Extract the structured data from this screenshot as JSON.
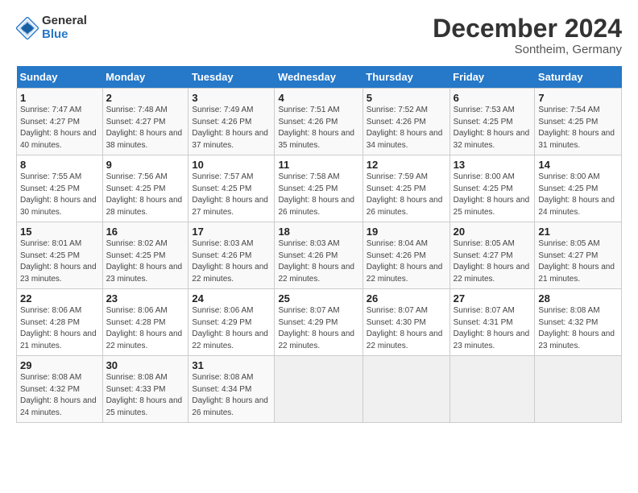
{
  "logo": {
    "general": "General",
    "blue": "Blue"
  },
  "header": {
    "month": "December 2024",
    "location": "Sontheim, Germany"
  },
  "days_of_week": [
    "Sunday",
    "Monday",
    "Tuesday",
    "Wednesday",
    "Thursday",
    "Friday",
    "Saturday"
  ],
  "weeks": [
    [
      {
        "num": "1",
        "sunrise": "Sunrise: 7:47 AM",
        "sunset": "Sunset: 4:27 PM",
        "daylight": "Daylight: 8 hours and 40 minutes."
      },
      {
        "num": "2",
        "sunrise": "Sunrise: 7:48 AM",
        "sunset": "Sunset: 4:27 PM",
        "daylight": "Daylight: 8 hours and 38 minutes."
      },
      {
        "num": "3",
        "sunrise": "Sunrise: 7:49 AM",
        "sunset": "Sunset: 4:26 PM",
        "daylight": "Daylight: 8 hours and 37 minutes."
      },
      {
        "num": "4",
        "sunrise": "Sunrise: 7:51 AM",
        "sunset": "Sunset: 4:26 PM",
        "daylight": "Daylight: 8 hours and 35 minutes."
      },
      {
        "num": "5",
        "sunrise": "Sunrise: 7:52 AM",
        "sunset": "Sunset: 4:26 PM",
        "daylight": "Daylight: 8 hours and 34 minutes."
      },
      {
        "num": "6",
        "sunrise": "Sunrise: 7:53 AM",
        "sunset": "Sunset: 4:25 PM",
        "daylight": "Daylight: 8 hours and 32 minutes."
      },
      {
        "num": "7",
        "sunrise": "Sunrise: 7:54 AM",
        "sunset": "Sunset: 4:25 PM",
        "daylight": "Daylight: 8 hours and 31 minutes."
      }
    ],
    [
      {
        "num": "8",
        "sunrise": "Sunrise: 7:55 AM",
        "sunset": "Sunset: 4:25 PM",
        "daylight": "Daylight: 8 hours and 30 minutes."
      },
      {
        "num": "9",
        "sunrise": "Sunrise: 7:56 AM",
        "sunset": "Sunset: 4:25 PM",
        "daylight": "Daylight: 8 hours and 28 minutes."
      },
      {
        "num": "10",
        "sunrise": "Sunrise: 7:57 AM",
        "sunset": "Sunset: 4:25 PM",
        "daylight": "Daylight: 8 hours and 27 minutes."
      },
      {
        "num": "11",
        "sunrise": "Sunrise: 7:58 AM",
        "sunset": "Sunset: 4:25 PM",
        "daylight": "Daylight: 8 hours and 26 minutes."
      },
      {
        "num": "12",
        "sunrise": "Sunrise: 7:59 AM",
        "sunset": "Sunset: 4:25 PM",
        "daylight": "Daylight: 8 hours and 26 minutes."
      },
      {
        "num": "13",
        "sunrise": "Sunrise: 8:00 AM",
        "sunset": "Sunset: 4:25 PM",
        "daylight": "Daylight: 8 hours and 25 minutes."
      },
      {
        "num": "14",
        "sunrise": "Sunrise: 8:00 AM",
        "sunset": "Sunset: 4:25 PM",
        "daylight": "Daylight: 8 hours and 24 minutes."
      }
    ],
    [
      {
        "num": "15",
        "sunrise": "Sunrise: 8:01 AM",
        "sunset": "Sunset: 4:25 PM",
        "daylight": "Daylight: 8 hours and 23 minutes."
      },
      {
        "num": "16",
        "sunrise": "Sunrise: 8:02 AM",
        "sunset": "Sunset: 4:25 PM",
        "daylight": "Daylight: 8 hours and 23 minutes."
      },
      {
        "num": "17",
        "sunrise": "Sunrise: 8:03 AM",
        "sunset": "Sunset: 4:26 PM",
        "daylight": "Daylight: 8 hours and 22 minutes."
      },
      {
        "num": "18",
        "sunrise": "Sunrise: 8:03 AM",
        "sunset": "Sunset: 4:26 PM",
        "daylight": "Daylight: 8 hours and 22 minutes."
      },
      {
        "num": "19",
        "sunrise": "Sunrise: 8:04 AM",
        "sunset": "Sunset: 4:26 PM",
        "daylight": "Daylight: 8 hours and 22 minutes."
      },
      {
        "num": "20",
        "sunrise": "Sunrise: 8:05 AM",
        "sunset": "Sunset: 4:27 PM",
        "daylight": "Daylight: 8 hours and 22 minutes."
      },
      {
        "num": "21",
        "sunrise": "Sunrise: 8:05 AM",
        "sunset": "Sunset: 4:27 PM",
        "daylight": "Daylight: 8 hours and 21 minutes."
      }
    ],
    [
      {
        "num": "22",
        "sunrise": "Sunrise: 8:06 AM",
        "sunset": "Sunset: 4:28 PM",
        "daylight": "Daylight: 8 hours and 21 minutes."
      },
      {
        "num": "23",
        "sunrise": "Sunrise: 8:06 AM",
        "sunset": "Sunset: 4:28 PM",
        "daylight": "Daylight: 8 hours and 22 minutes."
      },
      {
        "num": "24",
        "sunrise": "Sunrise: 8:06 AM",
        "sunset": "Sunset: 4:29 PM",
        "daylight": "Daylight: 8 hours and 22 minutes."
      },
      {
        "num": "25",
        "sunrise": "Sunrise: 8:07 AM",
        "sunset": "Sunset: 4:29 PM",
        "daylight": "Daylight: 8 hours and 22 minutes."
      },
      {
        "num": "26",
        "sunrise": "Sunrise: 8:07 AM",
        "sunset": "Sunset: 4:30 PM",
        "daylight": "Daylight: 8 hours and 22 minutes."
      },
      {
        "num": "27",
        "sunrise": "Sunrise: 8:07 AM",
        "sunset": "Sunset: 4:31 PM",
        "daylight": "Daylight: 8 hours and 23 minutes."
      },
      {
        "num": "28",
        "sunrise": "Sunrise: 8:08 AM",
        "sunset": "Sunset: 4:32 PM",
        "daylight": "Daylight: 8 hours and 23 minutes."
      }
    ],
    [
      {
        "num": "29",
        "sunrise": "Sunrise: 8:08 AM",
        "sunset": "Sunset: 4:32 PM",
        "daylight": "Daylight: 8 hours and 24 minutes."
      },
      {
        "num": "30",
        "sunrise": "Sunrise: 8:08 AM",
        "sunset": "Sunset: 4:33 PM",
        "daylight": "Daylight: 8 hours and 25 minutes."
      },
      {
        "num": "31",
        "sunrise": "Sunrise: 8:08 AM",
        "sunset": "Sunset: 4:34 PM",
        "daylight": "Daylight: 8 hours and 26 minutes."
      },
      null,
      null,
      null,
      null
    ]
  ]
}
